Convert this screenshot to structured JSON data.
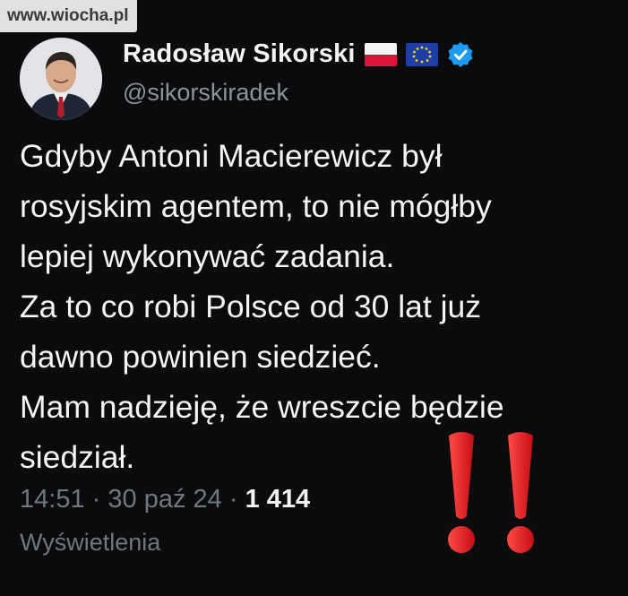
{
  "watermark": "www.wiocha.pl",
  "author": {
    "name": "Radosław Sikorski",
    "handle": "@sikorskiradek",
    "flags": [
      "poland-flag",
      "eu-flag"
    ],
    "verified": "verified-badge-icon"
  },
  "tweet": {
    "lines": [
      "Gdyby Antoni Macierewicz był",
      "rosyjskim agentem, to nie mógłby",
      "lepiej wykonywać zadania.",
      "Za to co robi Polsce od 30 lat już",
      "dawno powinien siedzieć.",
      "Mam nadzieję, że wreszcie będzie",
      "siedział."
    ]
  },
  "meta": {
    "time": "14:51",
    "separator": "·",
    "date": "30 paź 24",
    "views_count": "1 414",
    "views_label": "Wyświetlenia"
  },
  "colors": {
    "background": "#0b0b0d",
    "text": "#f4f4f4",
    "muted": "#6f7780",
    "verified": "#1d9bf0",
    "exclamation": "#e3131a"
  }
}
